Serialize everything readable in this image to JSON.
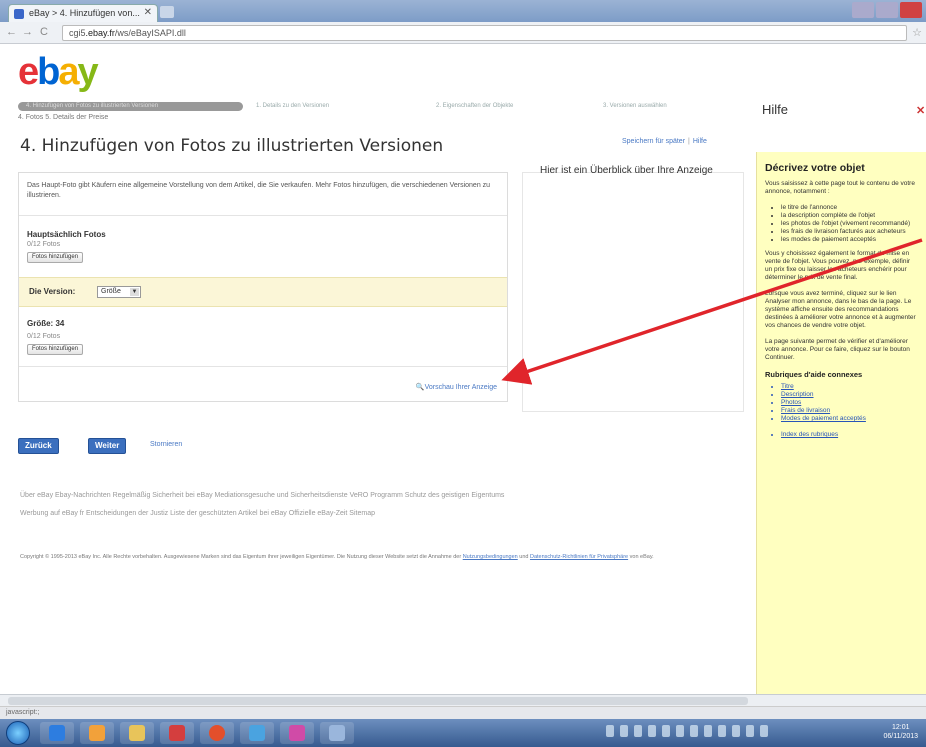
{
  "browser": {
    "tab_title": "eBay > 4. Hinzufügen von...",
    "url_prefix": "cgi5",
    "url_domain": ".ebay.fr",
    "url_path": "/ws/eBayISAPI.dll"
  },
  "header": {
    "logo": [
      "e",
      "b",
      "a",
      "y"
    ]
  },
  "steps": {
    "current_label": "4. Hinzufügen von Fotos zu illustrierten Versionen",
    "step_a": "1. Details zu den Versionen",
    "step_b": "2. Eigenschaften der Objekte",
    "step_c": "3. Versionen auswählen",
    "step_number": "4. Fotos   5. Details der Preise"
  },
  "page": {
    "title": "4. Hinzufügen von Fotos zu illustrierten Versionen",
    "save_link": "Speichern für später",
    "help_link": "Hilfe",
    "description": "Das Haupt-Foto gibt Käufern eine allgemeine Vorstellung von dem Artikel, die Sie verkaufen. Mehr Fotos hinzufügen, die verschiedenen Versionen zu illustrieren.",
    "main_photos_label": "Hauptsächlich Fotos",
    "main_photos_count": "0/12 Fotos",
    "add_photos_button": "Fotos hinzufügen",
    "version_label": "Die Version:",
    "version_select": "Größe",
    "size_label": "Größe:  34",
    "size_photos_count": "0/12 Fotos",
    "add_photos_button_2": "Fotos hinzufügen",
    "preview_link": "Vorschau Ihrer Anzeige",
    "overview_title": "Hier ist ein Überblick über Ihre Anzeige"
  },
  "actions": {
    "back": "Zurück",
    "next": "Weiter",
    "cancel": "Stornieren"
  },
  "footer": {
    "links_row1": "Über eBay    Ebay-Nachrichten    Regelmäßig    Sicherheit bei eBay    Mediationsgesuche und Sicherheitsdienste    VeRO Programm Schutz des geistigen Eigentums",
    "links_row2": "Werbung auf eBay fr    Entscheidungen der Justiz    Liste der geschützten Artikel bei eBay    Offizielle eBay-Zeit    Sitemap",
    "copyright": "Copyright © 1995-2013 eBay Inc. Alle Rechte vorbehalten. Ausgewiesene Marken sind das Eigentum ihrer jeweiligen Eigentümer. Die Nutzung dieser Website setzt die Annahme der",
    "copyright_link1": "Nutzungsbedingungen",
    "copyright_mid": " und ",
    "copyright_link2": "Datenschutz-Richtlinien für Privatsphäre",
    "copyright_end": " von eBay."
  },
  "help": {
    "header": "Hilfe",
    "title": "Décrivez votre objet",
    "intro": "Vous saisissez à cette page tout le contenu de votre annonce, notamment :",
    "items": [
      "le titre de l'annonce",
      "la description complète de l'objet",
      "les photos de l'objet (vivement recommandé)",
      "les frais de livraison facturés aux acheteurs",
      "les modes de paiement acceptés"
    ],
    "p2": "Vous y choisissez également le format de mise en vente de l'objet. Vous pouvez, par exemple, définir un prix fixe ou laisser les acheteurs enchérir pour déterminer le prix de vente final.",
    "p3": "Lorsque vous avez terminé, cliquez sur le lien Analyser mon annonce, dans le bas de la page. Le système affiche ensuite des recommandations destinées à améliorer votre annonce et à augmenter vos chances de vendre votre objet.",
    "p4": "La page suivante permet de vérifier et d'améliorer votre annonce. Pour ce faire, cliquez sur le bouton Continuer.",
    "common_title": "Rubriques d'aide connexes",
    "links": [
      "Titre",
      "Description",
      "Photos",
      "Frais de livraison",
      "Modes de paiement acceptés"
    ],
    "index_link": "Index des rubriques"
  },
  "statusbar": {
    "text": "javascript:;"
  },
  "clock": {
    "time": "12:01",
    "date": "06/11/2013"
  },
  "colors": {
    "arrow": "#e0252b",
    "ebay_blue": "#0064d2"
  }
}
